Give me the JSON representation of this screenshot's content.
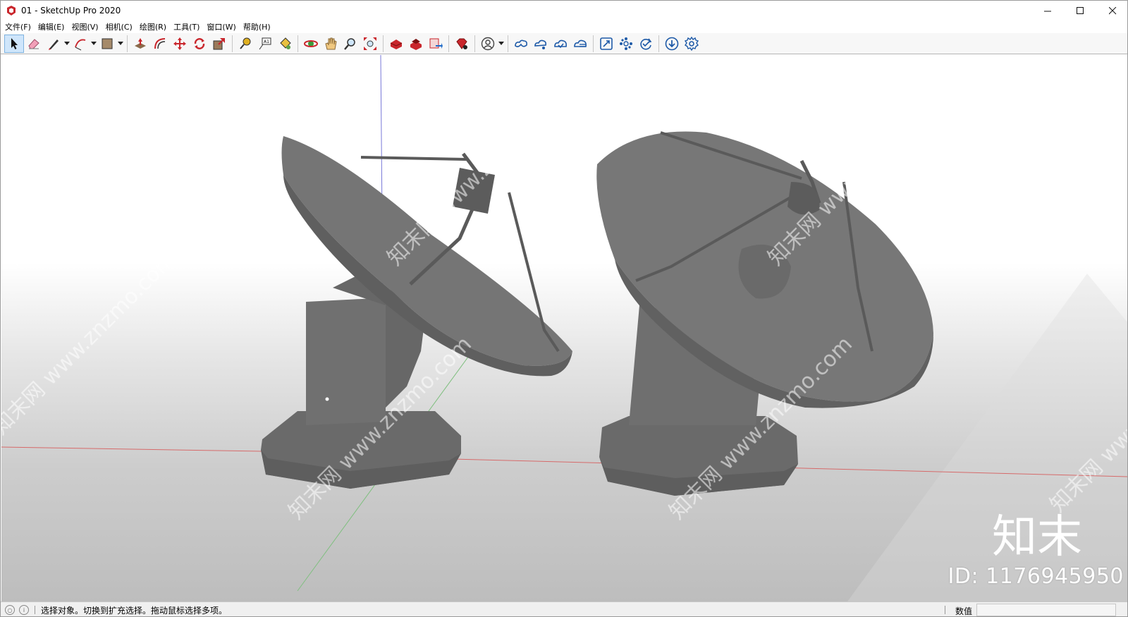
{
  "window": {
    "title": "01 - SketchUp Pro 2020",
    "controls": [
      "minimize-icon",
      "maximize-icon",
      "close-icon"
    ]
  },
  "menubar": {
    "items": [
      {
        "label": "文件(F)"
      },
      {
        "label": "编辑(E)"
      },
      {
        "label": "视图(V)"
      },
      {
        "label": "相机(C)"
      },
      {
        "label": "绘图(R)"
      },
      {
        "label": "工具(T)"
      },
      {
        "label": "窗口(W)"
      },
      {
        "label": "帮助(H)"
      }
    ]
  },
  "toolbar": {
    "tools": [
      {
        "icon": "select-arrow-icon",
        "selected": true
      },
      {
        "icon": "eraser-icon"
      },
      {
        "icon": "pencil-line-icon",
        "dropdown": true
      },
      {
        "icon": "arc-icon",
        "dropdown": true
      },
      {
        "icon": "rectangle-shape-icon",
        "dropdown": true
      },
      {
        "icon": "push-pull-icon"
      },
      {
        "icon": "offset-icon"
      },
      {
        "icon": "move-icon"
      },
      {
        "icon": "rotate-icon"
      },
      {
        "icon": "scale-icon"
      },
      {
        "icon": "tape-measure-icon"
      },
      {
        "icon": "text-label-icon"
      },
      {
        "icon": "paint-bucket-icon"
      },
      {
        "icon": "orbit-icon"
      },
      {
        "icon": "pan-hand-icon"
      },
      {
        "icon": "zoom-icon"
      },
      {
        "icon": "zoom-extents-icon"
      },
      {
        "icon": "warehouse-icon"
      },
      {
        "icon": "extension-warehouse-icon"
      },
      {
        "icon": "send-to-layout-icon"
      },
      {
        "icon": "ruby-console-icon"
      },
      {
        "icon": "account-icon",
        "dropdown": true
      },
      {
        "icon": "trimble-connect-icon"
      },
      {
        "icon": "cloud-share-icon"
      },
      {
        "icon": "cloud-open-icon"
      },
      {
        "icon": "cloud-list-icon"
      },
      {
        "icon": "fullscreen-icon"
      },
      {
        "icon": "components-icon"
      },
      {
        "icon": "sync-check-icon"
      },
      {
        "icon": "download-icon"
      },
      {
        "icon": "settings-gear-icon"
      }
    ]
  },
  "viewport": {
    "watermark_text": "知末网 www.znzmo.com",
    "brand_text": "知末",
    "id_text": "ID: 1176945950"
  },
  "statusbar": {
    "hint": "选择对象。切换到扩充选择。拖动鼠标选择多项。",
    "measure_label": "数值",
    "measure_value": ""
  },
  "colors": {
    "model_gray": "#6f6f6f",
    "axis_red": "#d66a6a",
    "axis_green": "#7fbf7f",
    "axis_blue": "#7878d8",
    "selected_tool": "#cfe6fb"
  }
}
